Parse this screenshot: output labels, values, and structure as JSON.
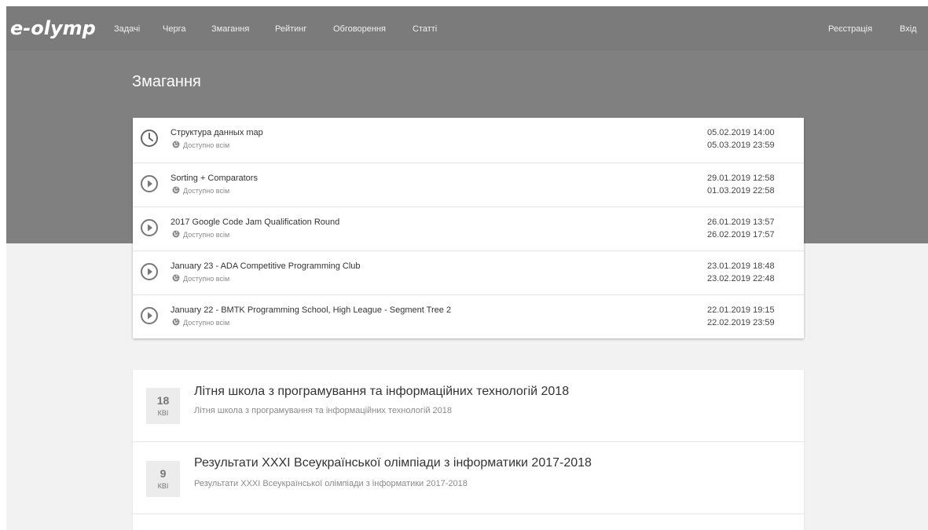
{
  "nav": {
    "logo": "e-olymp",
    "links": [
      "Задачі",
      "Черга",
      "Змагання",
      "Рейтинг",
      "Обговорення",
      "Статті"
    ],
    "register": "Реєстрація",
    "login": "Вхід"
  },
  "page_title": "Змагання",
  "contests": [
    {
      "title": "Структура данных map",
      "access": "Доступно всім",
      "start": "05.02.2019 14:00",
      "end": "05.03.2019 23:59",
      "status_icon": "clock-icon"
    },
    {
      "title": "Sorting + Comparators",
      "access": "Доступно всім",
      "start": "29.01.2019 12:58",
      "end": "01.03.2019 22:58",
      "status_icon": "play-circle-icon"
    },
    {
      "title": "2017 Google Code Jam Qualification Round",
      "access": "Доступно всім",
      "start": "26.01.2019 13:57",
      "end": "26.02.2019 17:57",
      "status_icon": "play-circle-icon"
    },
    {
      "title": "January 23 - ADA Competitive Programming Club",
      "access": "Доступно всім",
      "start": "23.01.2019 18:48",
      "end": "23.02.2019 22:48",
      "status_icon": "play-circle-icon"
    },
    {
      "title": "January 22 - BMTK Programming School, High League - Segment Tree 2",
      "access": "Доступно всім",
      "start": "22.01.2019 19:15",
      "end": "22.02.2019 23:59",
      "status_icon": "play-circle-icon"
    }
  ],
  "news": [
    {
      "day": "18",
      "month": "КВІ",
      "title": "Літня школа з програмування та інформаційних технологій 2018",
      "subtitle": "Літня школа з програмування та інформаційних технологій 2018"
    },
    {
      "day": "9",
      "month": "КВІ",
      "title": "Результати XXXI Всеукраїнської олімпіади з інформатики 2017-2018",
      "subtitle": "Результати XXXI Всеукраїнської олімпіади з інформатики 2017-2018"
    }
  ],
  "colors": {
    "navbar": "#7b7b7b",
    "hero": "#808080",
    "background": "#f2f2f2"
  }
}
